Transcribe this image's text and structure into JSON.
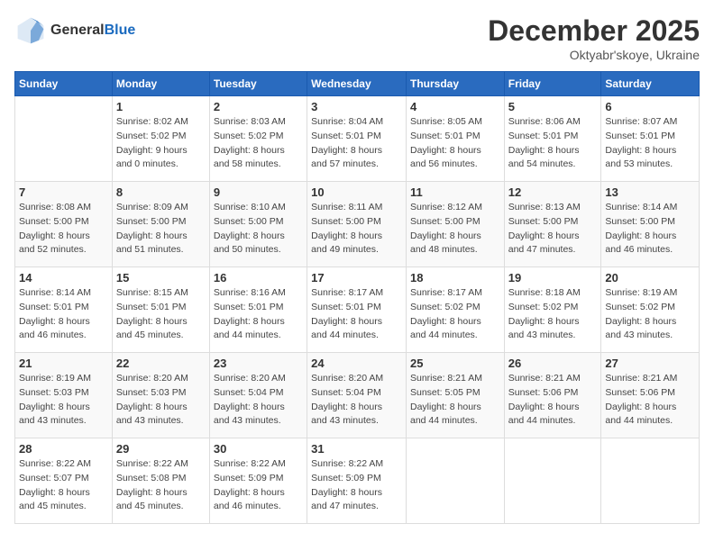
{
  "header": {
    "logo_line1": "General",
    "logo_line2": "Blue",
    "title": "December 2025",
    "subtitle": "Oktyabr'skoye, Ukraine"
  },
  "days_of_week": [
    "Sunday",
    "Monday",
    "Tuesday",
    "Wednesday",
    "Thursday",
    "Friday",
    "Saturday"
  ],
  "weeks": [
    [
      {
        "day": "",
        "sunrise": "",
        "sunset": "",
        "daylight": ""
      },
      {
        "day": "1",
        "sunrise": "Sunrise: 8:02 AM",
        "sunset": "Sunset: 5:02 PM",
        "daylight": "Daylight: 9 hours and 0 minutes."
      },
      {
        "day": "2",
        "sunrise": "Sunrise: 8:03 AM",
        "sunset": "Sunset: 5:02 PM",
        "daylight": "Daylight: 8 hours and 58 minutes."
      },
      {
        "day": "3",
        "sunrise": "Sunrise: 8:04 AM",
        "sunset": "Sunset: 5:01 PM",
        "daylight": "Daylight: 8 hours and 57 minutes."
      },
      {
        "day": "4",
        "sunrise": "Sunrise: 8:05 AM",
        "sunset": "Sunset: 5:01 PM",
        "daylight": "Daylight: 8 hours and 56 minutes."
      },
      {
        "day": "5",
        "sunrise": "Sunrise: 8:06 AM",
        "sunset": "Sunset: 5:01 PM",
        "daylight": "Daylight: 8 hours and 54 minutes."
      },
      {
        "day": "6",
        "sunrise": "Sunrise: 8:07 AM",
        "sunset": "Sunset: 5:01 PM",
        "daylight": "Daylight: 8 hours and 53 minutes."
      }
    ],
    [
      {
        "day": "7",
        "sunrise": "Sunrise: 8:08 AM",
        "sunset": "Sunset: 5:00 PM",
        "daylight": "Daylight: 8 hours and 52 minutes."
      },
      {
        "day": "8",
        "sunrise": "Sunrise: 8:09 AM",
        "sunset": "Sunset: 5:00 PM",
        "daylight": "Daylight: 8 hours and 51 minutes."
      },
      {
        "day": "9",
        "sunrise": "Sunrise: 8:10 AM",
        "sunset": "Sunset: 5:00 PM",
        "daylight": "Daylight: 8 hours and 50 minutes."
      },
      {
        "day": "10",
        "sunrise": "Sunrise: 8:11 AM",
        "sunset": "Sunset: 5:00 PM",
        "daylight": "Daylight: 8 hours and 49 minutes."
      },
      {
        "day": "11",
        "sunrise": "Sunrise: 8:12 AM",
        "sunset": "Sunset: 5:00 PM",
        "daylight": "Daylight: 8 hours and 48 minutes."
      },
      {
        "day": "12",
        "sunrise": "Sunrise: 8:13 AM",
        "sunset": "Sunset: 5:00 PM",
        "daylight": "Daylight: 8 hours and 47 minutes."
      },
      {
        "day": "13",
        "sunrise": "Sunrise: 8:14 AM",
        "sunset": "Sunset: 5:00 PM",
        "daylight": "Daylight: 8 hours and 46 minutes."
      }
    ],
    [
      {
        "day": "14",
        "sunrise": "Sunrise: 8:14 AM",
        "sunset": "Sunset: 5:01 PM",
        "daylight": "Daylight: 8 hours and 46 minutes."
      },
      {
        "day": "15",
        "sunrise": "Sunrise: 8:15 AM",
        "sunset": "Sunset: 5:01 PM",
        "daylight": "Daylight: 8 hours and 45 minutes."
      },
      {
        "day": "16",
        "sunrise": "Sunrise: 8:16 AM",
        "sunset": "Sunset: 5:01 PM",
        "daylight": "Daylight: 8 hours and 44 minutes."
      },
      {
        "day": "17",
        "sunrise": "Sunrise: 8:17 AM",
        "sunset": "Sunset: 5:01 PM",
        "daylight": "Daylight: 8 hours and 44 minutes."
      },
      {
        "day": "18",
        "sunrise": "Sunrise: 8:17 AM",
        "sunset": "Sunset: 5:02 PM",
        "daylight": "Daylight: 8 hours and 44 minutes."
      },
      {
        "day": "19",
        "sunrise": "Sunrise: 8:18 AM",
        "sunset": "Sunset: 5:02 PM",
        "daylight": "Daylight: 8 hours and 43 minutes."
      },
      {
        "day": "20",
        "sunrise": "Sunrise: 8:19 AM",
        "sunset": "Sunset: 5:02 PM",
        "daylight": "Daylight: 8 hours and 43 minutes."
      }
    ],
    [
      {
        "day": "21",
        "sunrise": "Sunrise: 8:19 AM",
        "sunset": "Sunset: 5:03 PM",
        "daylight": "Daylight: 8 hours and 43 minutes."
      },
      {
        "day": "22",
        "sunrise": "Sunrise: 8:20 AM",
        "sunset": "Sunset: 5:03 PM",
        "daylight": "Daylight: 8 hours and 43 minutes."
      },
      {
        "day": "23",
        "sunrise": "Sunrise: 8:20 AM",
        "sunset": "Sunset: 5:04 PM",
        "daylight": "Daylight: 8 hours and 43 minutes."
      },
      {
        "day": "24",
        "sunrise": "Sunrise: 8:20 AM",
        "sunset": "Sunset: 5:04 PM",
        "daylight": "Daylight: 8 hours and 43 minutes."
      },
      {
        "day": "25",
        "sunrise": "Sunrise: 8:21 AM",
        "sunset": "Sunset: 5:05 PM",
        "daylight": "Daylight: 8 hours and 44 minutes."
      },
      {
        "day": "26",
        "sunrise": "Sunrise: 8:21 AM",
        "sunset": "Sunset: 5:06 PM",
        "daylight": "Daylight: 8 hours and 44 minutes."
      },
      {
        "day": "27",
        "sunrise": "Sunrise: 8:21 AM",
        "sunset": "Sunset: 5:06 PM",
        "daylight": "Daylight: 8 hours and 44 minutes."
      }
    ],
    [
      {
        "day": "28",
        "sunrise": "Sunrise: 8:22 AM",
        "sunset": "Sunset: 5:07 PM",
        "daylight": "Daylight: 8 hours and 45 minutes."
      },
      {
        "day": "29",
        "sunrise": "Sunrise: 8:22 AM",
        "sunset": "Sunset: 5:08 PM",
        "daylight": "Daylight: 8 hours and 45 minutes."
      },
      {
        "day": "30",
        "sunrise": "Sunrise: 8:22 AM",
        "sunset": "Sunset: 5:09 PM",
        "daylight": "Daylight: 8 hours and 46 minutes."
      },
      {
        "day": "31",
        "sunrise": "Sunrise: 8:22 AM",
        "sunset": "Sunset: 5:09 PM",
        "daylight": "Daylight: 8 hours and 47 minutes."
      },
      {
        "day": "",
        "sunrise": "",
        "sunset": "",
        "daylight": ""
      },
      {
        "day": "",
        "sunrise": "",
        "sunset": "",
        "daylight": ""
      },
      {
        "day": "",
        "sunrise": "",
        "sunset": "",
        "daylight": ""
      }
    ]
  ]
}
